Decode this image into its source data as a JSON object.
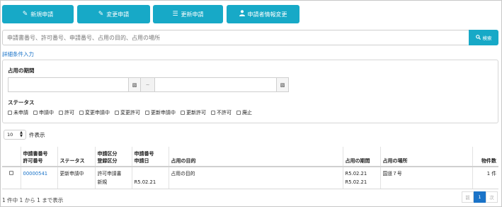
{
  "top_buttons": [
    {
      "label": "新規申請",
      "icon": "edit-icon"
    },
    {
      "label": "変更申請",
      "icon": "edit-icon"
    },
    {
      "label": "更新申請",
      "icon": "list-icon"
    },
    {
      "label": "申請者情報変更",
      "icon": "user-icon"
    }
  ],
  "search": {
    "placeholder": "申請書番号、許可番号、申請番号、占用の目的、占用の場所",
    "button_label": "検索"
  },
  "advanced_link": "詳細条件入力",
  "filters": {
    "period_label": "占用の期間",
    "tilde": "~",
    "status_label": "ステータス",
    "statuses": [
      "未申請",
      "申請中",
      "許可",
      "変更申請中",
      "変更許可",
      "更新申請中",
      "更新許可",
      "不許可",
      "廃止"
    ]
  },
  "page_size": {
    "value": "10",
    "suffix": "件表示"
  },
  "table": {
    "headers": {
      "col1_line1": "申請書番号",
      "col1_line2": "許可番号",
      "status": "ステータス",
      "col3_line1": "申請区分",
      "col3_line2": "登録区分",
      "col4_line1": "申請番号",
      "col4_line2": "申請日",
      "purpose": "占用の目的",
      "period": "占用の期間",
      "place": "占用の場所",
      "count": "物件数"
    },
    "rows": [
      {
        "number": "00000541",
        "status": "更新申請中",
        "class_line1": "許可申請書",
        "class_line2": "新規",
        "apply_date": "R5.02.21",
        "purpose": "占用の目的",
        "period_from": "R5.02.21",
        "period_to": "R5.02.21",
        "place": "国道７号",
        "count": "1 件"
      }
    ]
  },
  "footer": {
    "info": "1 件中 1 から 1 まで表示"
  },
  "pager": {
    "prev": "前",
    "current": "1",
    "next": "次"
  },
  "colors": {
    "accent": "#17a9c7",
    "link": "#1a73c8"
  }
}
